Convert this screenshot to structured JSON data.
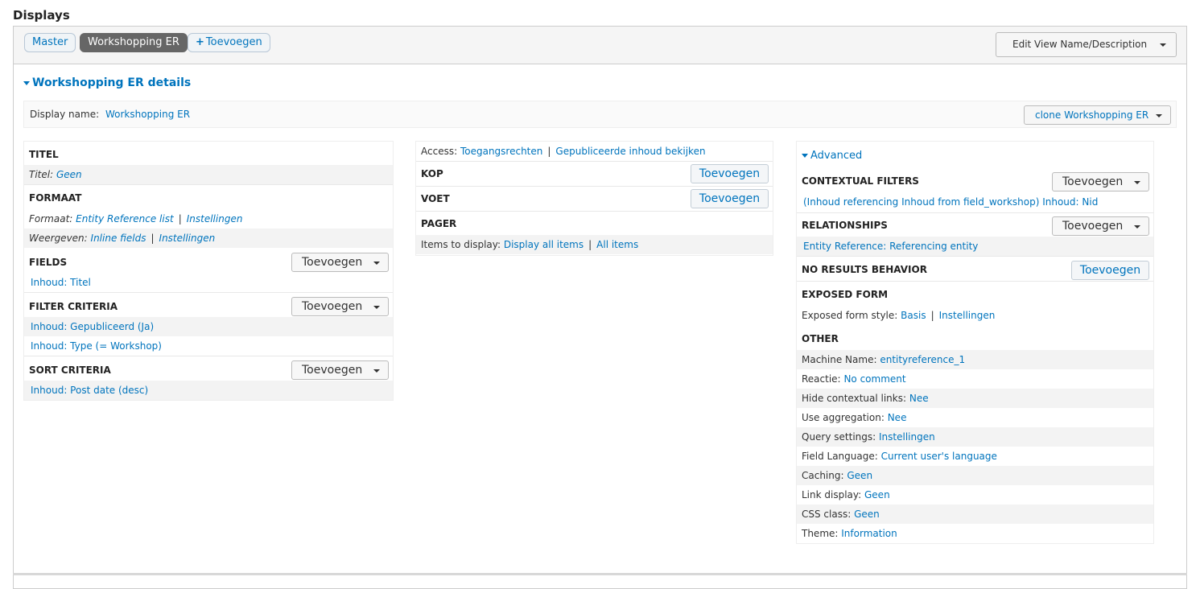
{
  "page_title": "Displays",
  "tabs": {
    "master": "Master",
    "active": "Workshopping ER",
    "add": "Toevoegen",
    "add_symbol": "+"
  },
  "edit_view_button": "Edit View Name/Description",
  "details_header": "Workshopping ER details",
  "display_name": {
    "label": "Display name:",
    "value": "Workshopping ER",
    "clone_button": "clone Workshopping ER"
  },
  "col1": {
    "titel": {
      "heading": "TITEL",
      "label": "Titel:",
      "value": "Geen"
    },
    "formaat": {
      "heading": "FORMAAT",
      "formaat_label": "Formaat:",
      "formaat_value": "Entity Reference list",
      "formaat_settings": "Instellingen",
      "weergeven_label": "Weergeven:",
      "weergeven_value": "Inline fields",
      "weergeven_settings": "Instellingen"
    },
    "fields": {
      "heading": "FIELDS",
      "add": "Toevoegen",
      "items": [
        "Inhoud: Titel"
      ]
    },
    "filter": {
      "heading": "FILTER CRITERIA",
      "add": "Toevoegen",
      "items": [
        "Inhoud: Gepubliceerd (Ja)",
        "Inhoud: Type (= Workshop)"
      ]
    },
    "sort": {
      "heading": "SORT CRITERIA",
      "add": "Toevoegen",
      "items": [
        "Inhoud: Post date (desc)"
      ]
    }
  },
  "col2": {
    "access": {
      "label": "Access:",
      "value1": "Toegangsrechten",
      "value2": "Gepubliceerde inhoud bekijken"
    },
    "kop": {
      "heading": "KOP",
      "add": "Toevoegen"
    },
    "voet": {
      "heading": "VOET",
      "add": "Toevoegen"
    },
    "pager": {
      "heading": "PAGER",
      "label": "Items to display:",
      "value": "Display all items",
      "value2": "All items"
    }
  },
  "col3": {
    "advanced": "Advanced",
    "contextual": {
      "heading": "CONTEXTUAL FILTERS",
      "add": "Toevoegen",
      "item": "(Inhoud referencing Inhoud from field_workshop) Inhoud: Nid"
    },
    "relationships": {
      "heading": "RELATIONSHIPS",
      "add": "Toevoegen",
      "item": "Entity Reference: Referencing entity"
    },
    "no_results": {
      "heading": "NO RESULTS BEHAVIOR",
      "add": "Toevoegen"
    },
    "exposed": {
      "heading": "EXPOSED FORM",
      "label": "Exposed form style:",
      "value": "Basis",
      "settings": "Instellingen"
    },
    "other": {
      "heading": "OTHER",
      "rows": [
        {
          "label": "Machine Name:",
          "value": "entityreference_1"
        },
        {
          "label": "Reactie:",
          "value": "No comment"
        },
        {
          "label": "Hide contextual links:",
          "value": "Nee"
        },
        {
          "label": "Use aggregation:",
          "value": "Nee"
        },
        {
          "label": "Query settings:",
          "value": "Instellingen"
        },
        {
          "label": "Field Language:",
          "value": "Current user's language"
        },
        {
          "label": "Caching:",
          "value": "Geen"
        },
        {
          "label": "Link display:",
          "value": "Geen"
        },
        {
          "label": "CSS class:",
          "value": "Geen"
        },
        {
          "label": "Theme:",
          "value": "Information"
        }
      ]
    }
  },
  "colors": {
    "link": "#0074bd",
    "active_tab": "#666666",
    "shade": "#f3f3f3"
  }
}
